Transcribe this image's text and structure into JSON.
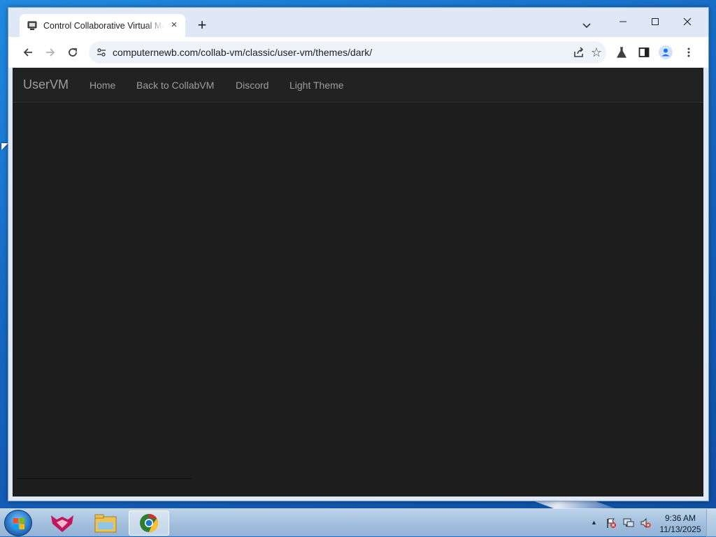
{
  "browser": {
    "tab_title": "Control Collaborative Virtual Machines",
    "tab_close": "×",
    "new_tab": "+",
    "url": "computernewb.com/collab-vm/classic/user-vm/themes/dark/",
    "icons": {
      "favicon": "computer-icon",
      "back": "back-arrow-icon",
      "forward": "forward-arrow-icon",
      "reload": "reload-icon",
      "site_info": "tune-icon",
      "share": "share-icon",
      "bookmark": "star-icon",
      "labs": "flask-icon",
      "side_panel": "side-panel-icon",
      "profile": "profile-icon",
      "menu": "kebab-menu-icon"
    }
  },
  "page": {
    "brand": "UserVM",
    "nav": [
      "Home",
      "Back to CollabVM",
      "Discord",
      "Light Theme"
    ],
    "colors": {
      "navbar_bg": "#222222",
      "page_bg": "#1d1d1d",
      "link": "#9d9d9d"
    }
  },
  "taskbar": {
    "time": "9:36 AM",
    "date": "11/13/2025",
    "apps": [
      "collabvm-fox-icon",
      "file-explorer-icon",
      "chrome-icon"
    ]
  }
}
